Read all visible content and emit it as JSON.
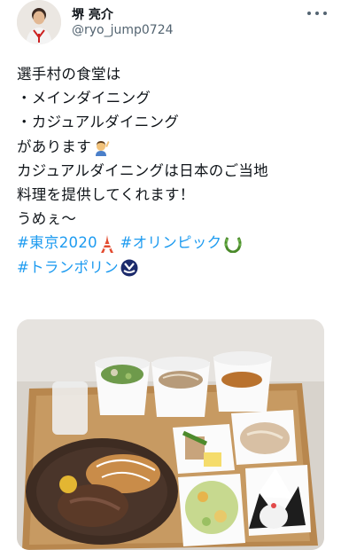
{
  "author": {
    "display_name": "堺 亮介",
    "handle": "@ryo_jump0724"
  },
  "tweet": {
    "line1": "選手村の食堂は",
    "line2": "・メインダイニング",
    "line3": "・カジュアルダイニング",
    "line4": "があります",
    "line5": "カジュアルダイニングは日本のご当地",
    "line6": "料理を提供してくれます！",
    "line7": "うめぇ〜",
    "hashtag_tokyo": "#東京2020",
    "hashtag_olympic": "#オリンピック",
    "hashtag_trampoline": "#トランポリン"
  },
  "icons": {
    "avatar": "profile-photo",
    "more": "more-options-icon",
    "emoji_person": "person-raising-hand-emoji",
    "emoji_tower": "tokyo-tower-emoji",
    "emoji_olympic": "olympic-wreath-emoji",
    "emoji_trampoline": "trampoline-emblem-emoji"
  },
  "colors": {
    "text": "#0f1419",
    "secondary": "#536471",
    "link": "#1d9bf0"
  }
}
